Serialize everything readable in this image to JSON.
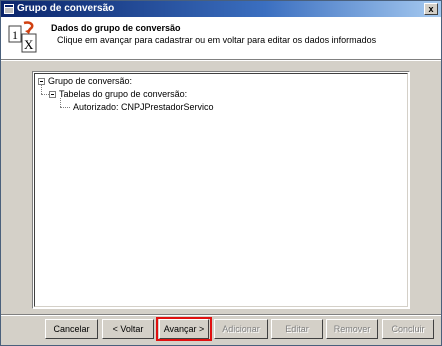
{
  "window": {
    "title": "Grupo de conversão",
    "close_label": "x"
  },
  "header": {
    "title": "Dados do grupo de conversão",
    "subtitle": "Clique em avançar para cadastrar ou em voltar para editar os dados informados",
    "icon_text": [
      "1",
      "X"
    ]
  },
  "tree": {
    "root": "Grupo de conversão:",
    "child": "Tabelas do grupo de conversão:",
    "leaf": "Autorizado: CNPJPrestadorServico"
  },
  "buttons": {
    "cancel": "Cancelar",
    "back": "< Voltar",
    "next": "Avançar >",
    "add": "Adicionar",
    "edit": "Editar",
    "remove": "Remover",
    "finish": "Concluir"
  },
  "colors": {
    "highlight": "#e01010",
    "titlebar": "#0a246a"
  }
}
